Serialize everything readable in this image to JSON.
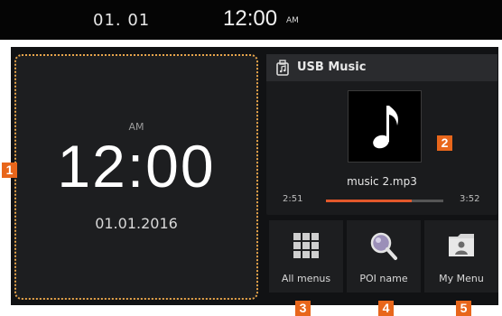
{
  "status_bar": {
    "date": "01. 01",
    "time": "12:00",
    "ampm": "AM"
  },
  "clock": {
    "ampm": "AM",
    "time": "12:00",
    "date": "01.01.2016"
  },
  "music": {
    "source_label": "USB Music",
    "track": "music 2.mp3",
    "elapsed": "2:51",
    "total": "3:52",
    "progress": 0.73
  },
  "shortcuts": [
    {
      "label": "All menus",
      "icon": "grid-icon"
    },
    {
      "label": "POI name",
      "icon": "magnifier-icon"
    },
    {
      "label": "My Menu",
      "icon": "folder-user-icon"
    }
  ],
  "callouts": [
    "1",
    "2",
    "3",
    "4",
    "5"
  ],
  "colors": {
    "accent": "#e8661b",
    "progress": "#e2582b",
    "screen_bg": "#111214"
  }
}
